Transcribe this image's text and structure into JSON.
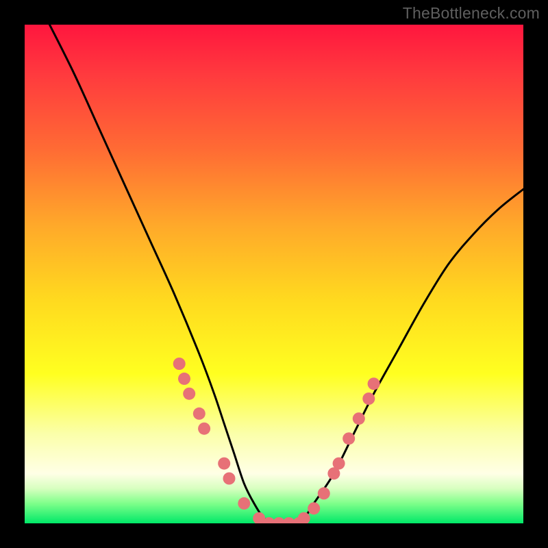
{
  "watermark": "TheBottleneck.com",
  "chart_data": {
    "type": "line",
    "title": "",
    "xlabel": "",
    "ylabel": "",
    "xlim": [
      0,
      100
    ],
    "ylim": [
      0,
      100
    ],
    "series": [
      {
        "name": "bottleneck-curve",
        "x": [
          5,
          10,
          15,
          20,
          25,
          30,
          35,
          38,
          40,
          42,
          44,
          46,
          48,
          50,
          52,
          54,
          56,
          58,
          62,
          66,
          70,
          75,
          80,
          85,
          90,
          95,
          100
        ],
        "y": [
          100,
          90,
          79,
          68,
          57,
          46,
          34,
          26,
          20,
          14,
          8,
          4,
          1,
          0,
          0,
          0,
          1,
          4,
          10,
          18,
          26,
          35,
          44,
          52,
          58,
          63,
          67
        ]
      }
    ],
    "markers": {
      "name": "highlighted-points",
      "color": "#e77177",
      "points": [
        {
          "x": 31,
          "y": 32
        },
        {
          "x": 32,
          "y": 29
        },
        {
          "x": 33,
          "y": 26
        },
        {
          "x": 35,
          "y": 22
        },
        {
          "x": 36,
          "y": 19
        },
        {
          "x": 40,
          "y": 12
        },
        {
          "x": 41,
          "y": 9
        },
        {
          "x": 44,
          "y": 4
        },
        {
          "x": 47,
          "y": 1
        },
        {
          "x": 49,
          "y": 0
        },
        {
          "x": 51,
          "y": 0
        },
        {
          "x": 53,
          "y": 0
        },
        {
          "x": 55,
          "y": 0
        },
        {
          "x": 56,
          "y": 1
        },
        {
          "x": 58,
          "y": 3
        },
        {
          "x": 60,
          "y": 6
        },
        {
          "x": 62,
          "y": 10
        },
        {
          "x": 63,
          "y": 12
        },
        {
          "x": 65,
          "y": 17
        },
        {
          "x": 67,
          "y": 21
        },
        {
          "x": 69,
          "y": 25
        },
        {
          "x": 70,
          "y": 28
        }
      ]
    }
  }
}
